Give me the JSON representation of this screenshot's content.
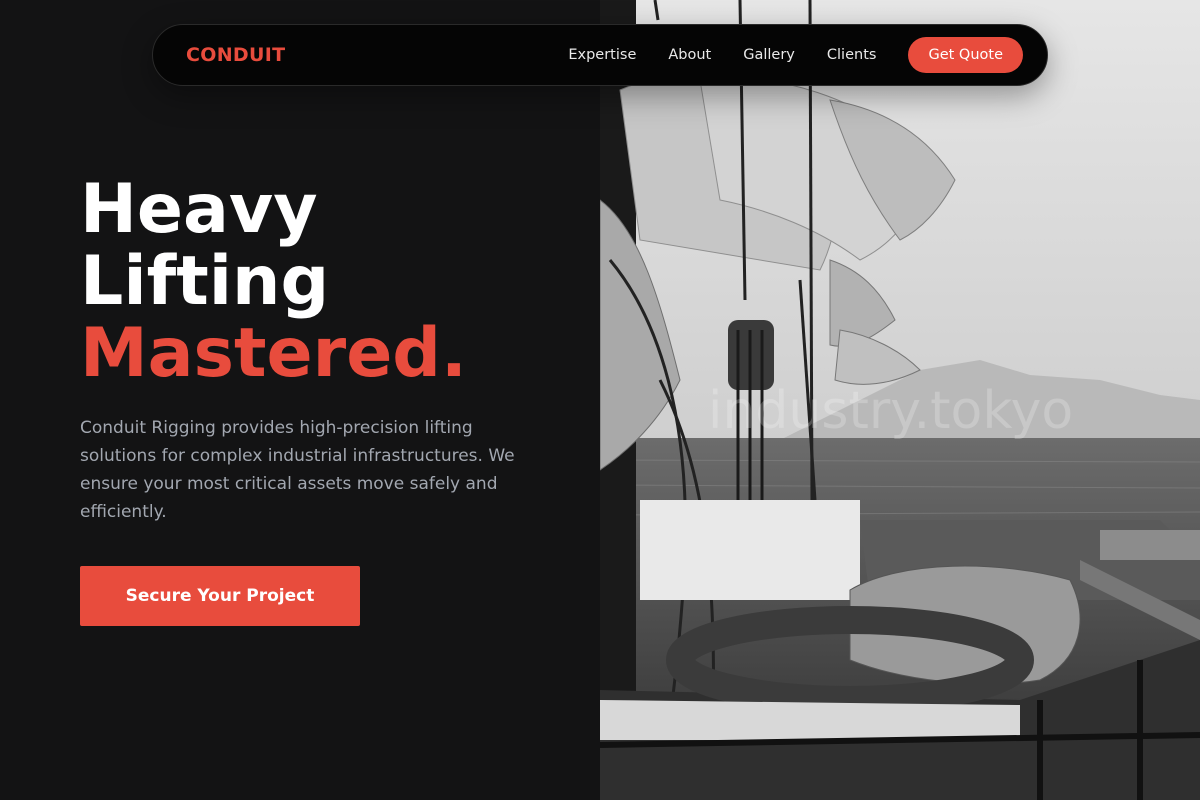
{
  "nav": {
    "logo": "CONDUIT",
    "links": [
      "Expertise",
      "About",
      "Gallery",
      "Clients"
    ],
    "cta": "Get Quote"
  },
  "hero": {
    "title_line1": "Heavy",
    "title_line2": "Lifting",
    "title_accent": "Mastered.",
    "description": "Conduit Rigging provides high-precision lifting solutions for complex industrial infrastructures. We ensure your most critical assets move safely and efficiently.",
    "cta": "Secure Your Project"
  },
  "photo": {
    "subject": "grayscale photo of sailboat rigging, sails and pulleys over the sea",
    "watermark": "industry.tokyo"
  },
  "colors": {
    "accent": "#e84c3d",
    "background": "#131314",
    "nav_background": "#050505",
    "body_text": "#a2a7b0"
  }
}
